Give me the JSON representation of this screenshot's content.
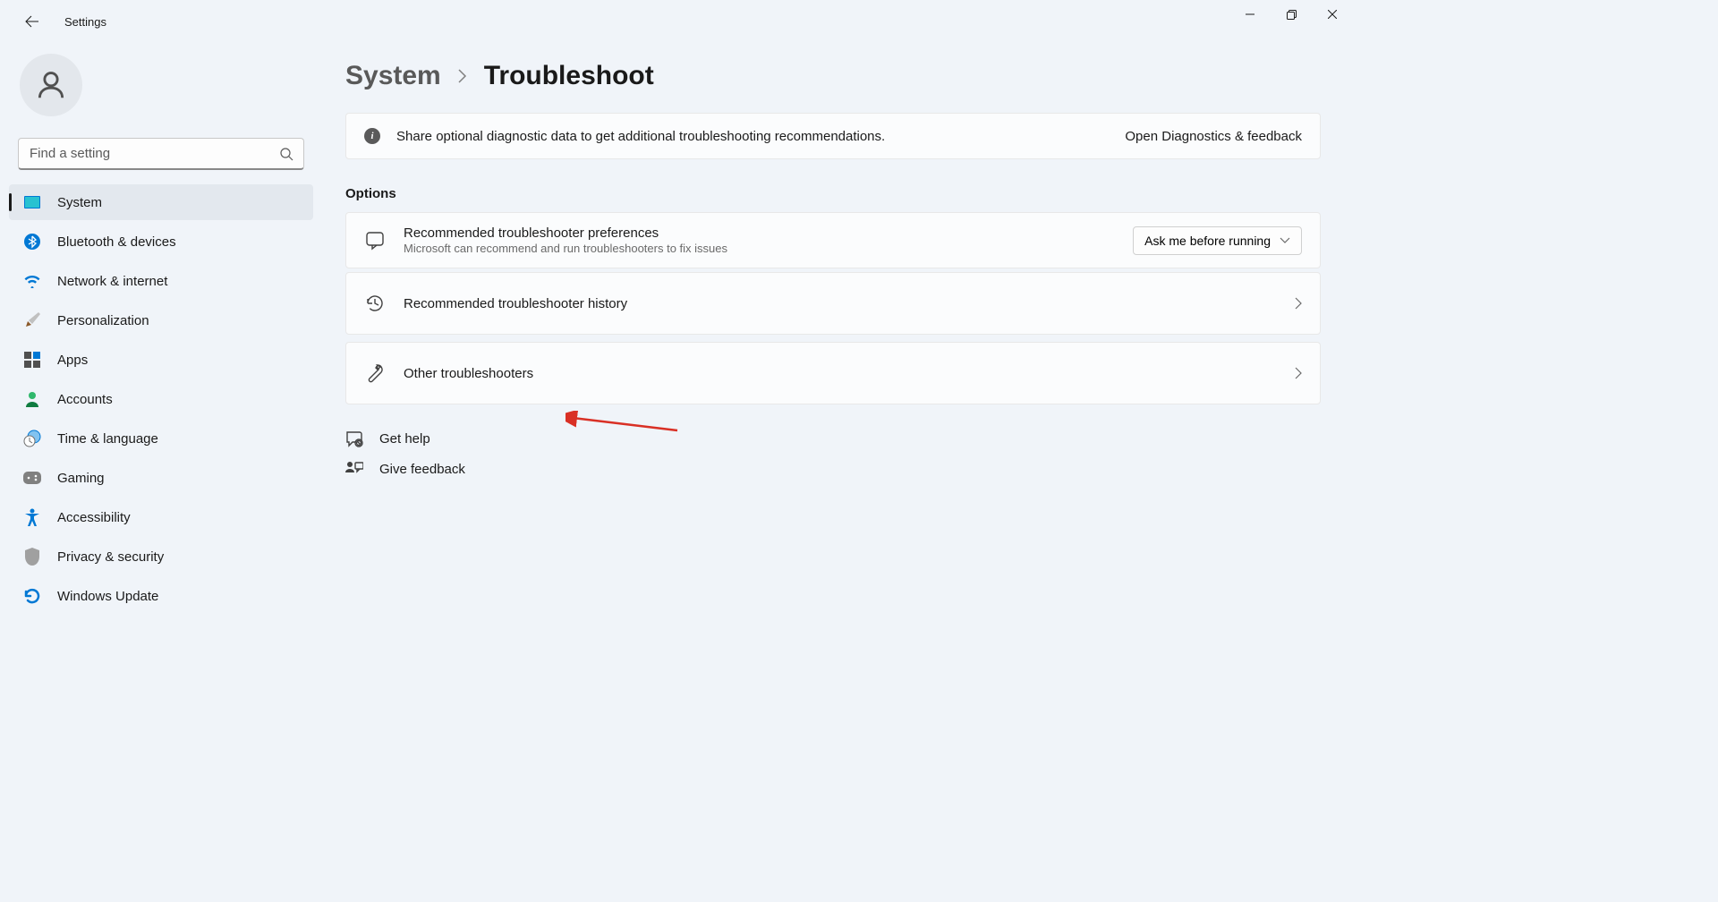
{
  "app": {
    "title": "Settings"
  },
  "search": {
    "placeholder": "Find a setting"
  },
  "sidebar": {
    "items": [
      {
        "label": "System"
      },
      {
        "label": "Bluetooth & devices"
      },
      {
        "label": "Network & internet"
      },
      {
        "label": "Personalization"
      },
      {
        "label": "Apps"
      },
      {
        "label": "Accounts"
      },
      {
        "label": "Time & language"
      },
      {
        "label": "Gaming"
      },
      {
        "label": "Accessibility"
      },
      {
        "label": "Privacy & security"
      },
      {
        "label": "Windows Update"
      }
    ]
  },
  "breadcrumb": {
    "parent": "System",
    "current": "Troubleshoot"
  },
  "banner": {
    "text": "Share optional diagnostic data to get additional troubleshooting recommendations.",
    "link": "Open Diagnostics & feedback"
  },
  "options": {
    "title": "Options",
    "recommended_prefs": {
      "title": "Recommended troubleshooter preferences",
      "subtitle": "Microsoft can recommend and run troubleshooters to fix issues",
      "dropdown_value": "Ask me before running"
    },
    "history": {
      "title": "Recommended troubleshooter history"
    },
    "other": {
      "title": "Other troubleshooters"
    }
  },
  "footer": {
    "help": "Get help",
    "feedback": "Give feedback"
  }
}
